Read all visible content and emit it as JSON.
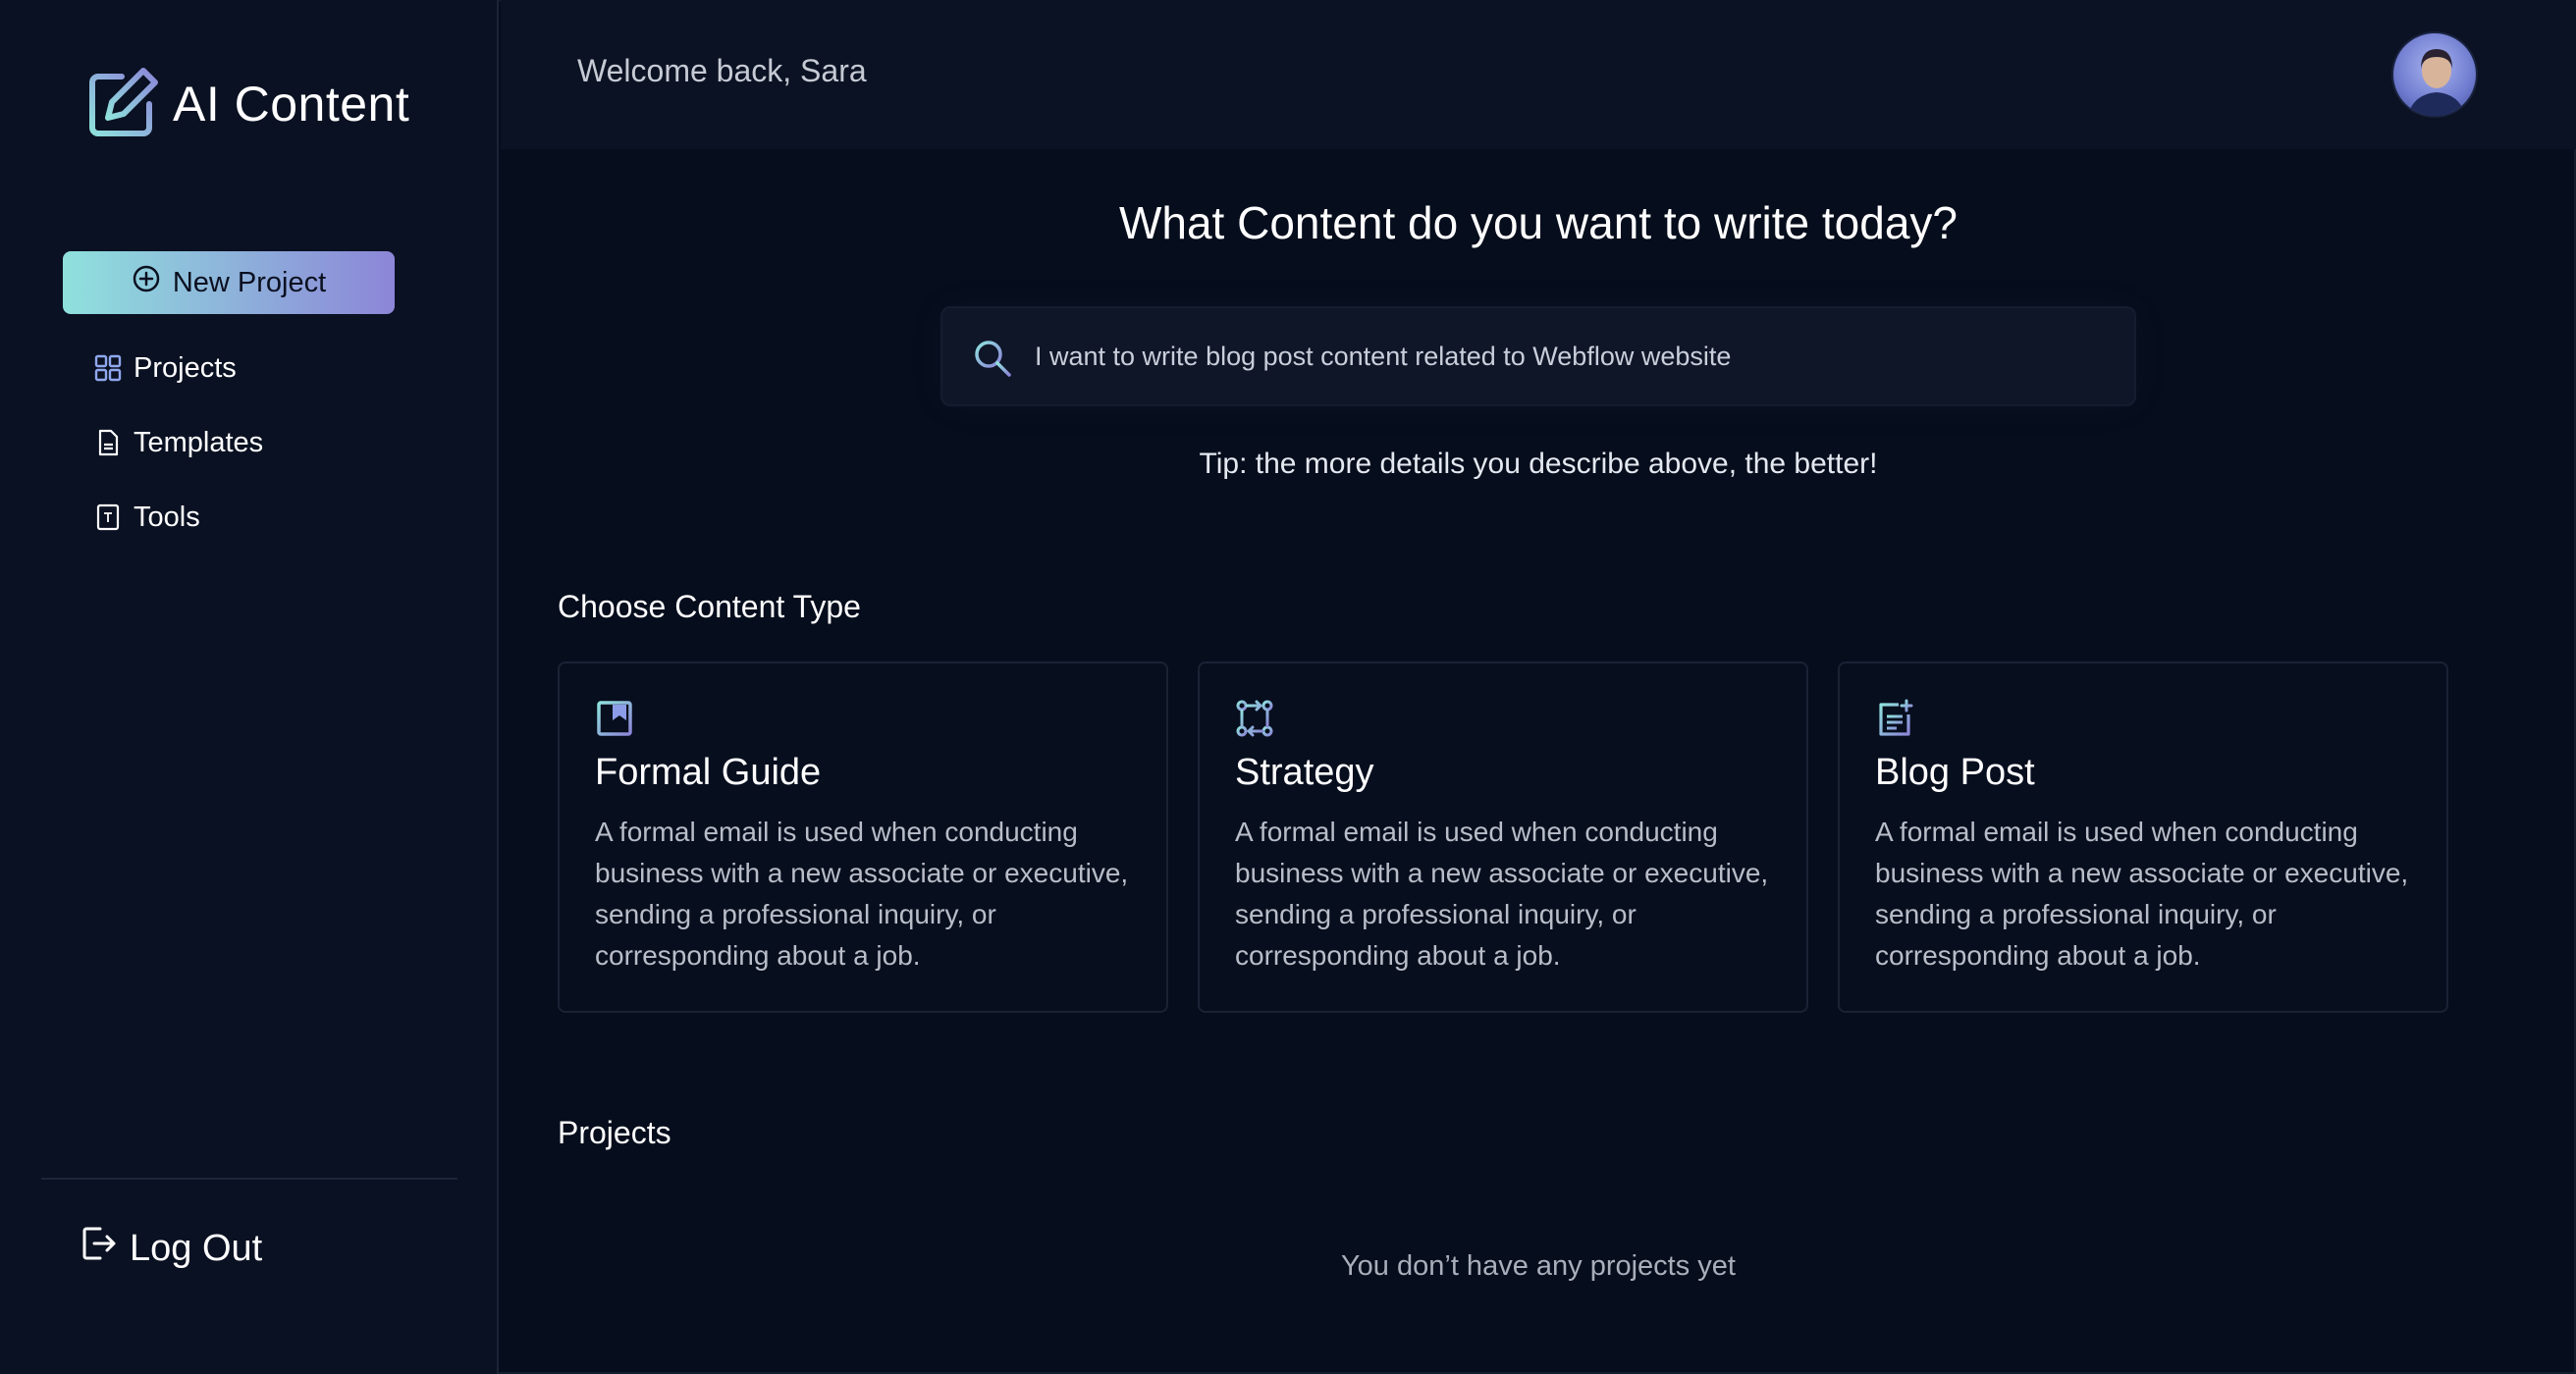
{
  "app": {
    "name": "AI Content"
  },
  "sidebar": {
    "new_project_label": "New Project",
    "items": [
      {
        "label": "Projects",
        "icon": "grid-icon"
      },
      {
        "label": "Templates",
        "icon": "document-icon"
      },
      {
        "label": "Tools",
        "icon": "tool-icon"
      }
    ],
    "logout_label": "Log Out"
  },
  "header": {
    "welcome": "Welcome back, Sara"
  },
  "main": {
    "title": "What Content do you want to write today?",
    "search": {
      "value": "I want to write blog post content related to Webflow website"
    },
    "tip": "Tip: the more details you describe above, the better!",
    "content_type_heading": "Choose Content Type",
    "cards": [
      {
        "title": "Formal Guide",
        "icon": "bookmark-icon",
        "description": "A formal email is used when conducting business with a new associate or executive, sending a professional inquiry, or corresponding about a job."
      },
      {
        "title": "Strategy",
        "icon": "git-compare-icon",
        "description": "A formal email is used when conducting business with a new associate or executive, sending a professional inquiry, or corresponding about a job."
      },
      {
        "title": "Blog Post",
        "icon": "note-add-icon",
        "description": "A formal email is used when conducting business with a new associate or executive, sending a professional inquiry, or corresponding about a job."
      }
    ],
    "projects_heading": "Projects",
    "projects_empty": "You don’t have any projects yet"
  },
  "colors": {
    "background": "#060d1c",
    "sidebar": "#0a1122",
    "accent_start": "#8fe1dd",
    "accent_end": "#8c86d8"
  }
}
